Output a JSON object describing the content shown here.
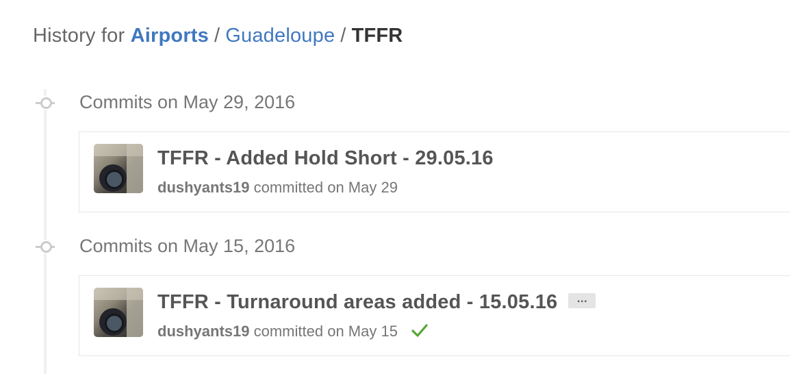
{
  "breadcrumb": {
    "prefix": "History for",
    "path": [
      "Airports",
      "Guadeloupe"
    ],
    "separator": "/",
    "current": "TFFR"
  },
  "groups": [
    {
      "title": "Commits on May 29, 2016",
      "commits": [
        {
          "message": "TFFR - Added Hold Short - 29.05.16",
          "author": "dushyants19",
          "committed_text": "committed on May 29",
          "status": "",
          "has_ellipsis": false
        }
      ]
    },
    {
      "title": "Commits on May 15, 2016",
      "commits": [
        {
          "message": "TFFR - Turnaround areas added - 15.05.16",
          "ellipsis": "…",
          "author": "dushyants19",
          "committed_text": "committed on May 15",
          "status": "success",
          "has_ellipsis": true
        }
      ]
    }
  ],
  "colors": {
    "link": "#4078c0",
    "success": "#55a532",
    "text_muted": "#767676"
  }
}
